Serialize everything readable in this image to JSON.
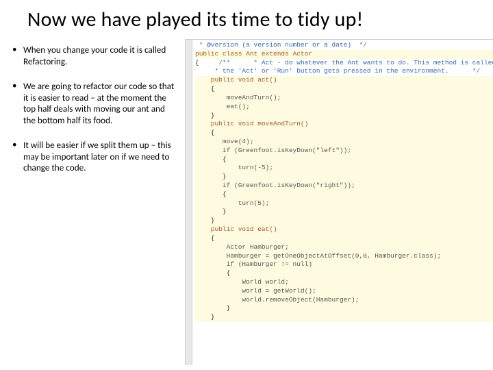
{
  "title": "Now we have played its time to tidy up!",
  "bullets": [
    "When you change your code it is called Refactoring.",
    "We are going to refactor our code so that it is easier to read – at the moment the top half deals with moving our ant and the bottom half its food.",
    "It will be easier if we split them up – this may be important later on if we need to change the code."
  ],
  "code": {
    "l0": " * @version (a version number or a date)",
    "l1": " */",
    "l2": "public class Ant extends Actor",
    "l3": "{",
    "l4": "    /**",
    "l5": "     * Act - do whatever the Ant wants to do. This method is called wheneve",
    "l6": "     * the 'Act' or 'Run' button gets pressed in the environment.",
    "l7": "     */",
    "l8": "    public void act()",
    "l9": "    {",
    "l10": "        moveAndTurn();",
    "l11": "        eat();",
    "l12": "    }",
    "l13": "    public void moveAndTurn()",
    "l14": "    {",
    "l15": "       move(4);",
    "l16": "",
    "l17": "       if (Greenfoot.isKeyDown(\"left\"));",
    "l18": "       {",
    "l19": "           turn(-5);",
    "l20": "       }",
    "l21": "       if (Greenfoot.isKeyDown(\"right\"));",
    "l22": "       {",
    "l23": "           turn(5);",
    "l24": "       }",
    "l25": "    }",
    "l26": "",
    "l27": "    public void eat()",
    "l28": "    {",
    "l29": "        Actor Hamburger;",
    "l30": "        Hamburger = getOneObjectAtOffset(0,0, Hamburger.class);",
    "l31": "        if (Hamburger != null)",
    "l32": "        {",
    "l33": "            World world;",
    "l34": "            world = getWorld();",
    "l35": "            world.removeObject(Hamburger);",
    "l36": "        }",
    "l37": "    }"
  }
}
